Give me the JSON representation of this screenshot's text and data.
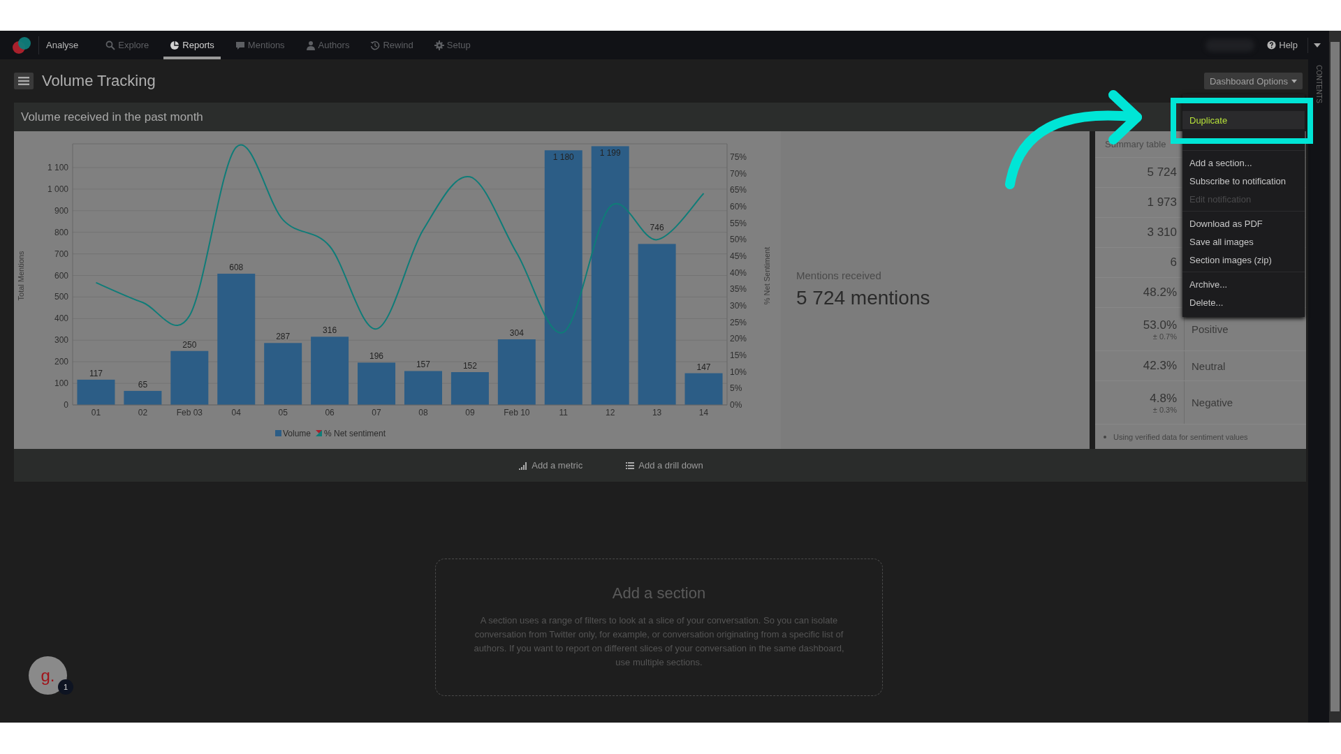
{
  "nav": {
    "app_label": "Analyse",
    "items": [
      {
        "label": "Explore",
        "selected": false
      },
      {
        "label": "Reports",
        "selected": true
      },
      {
        "label": "Mentions",
        "selected": false
      },
      {
        "label": "Authors",
        "selected": false
      },
      {
        "label": "Rewind",
        "selected": false
      },
      {
        "label": "Setup",
        "selected": false
      }
    ],
    "help": "Help"
  },
  "page": {
    "title": "Volume Tracking",
    "options_button": "Dashboard Options",
    "side_tab": "CONTENTS"
  },
  "section": {
    "title": "Volume received in the past month",
    "charts": [
      {
        "chart_data": {
          "type": "bar",
          "ylabel": "Total Mentions",
          "categories": [
            "01",
            "02",
            "Feb 03",
            "04",
            "05",
            "06",
            "07",
            "08",
            "09",
            "Feb 10",
            "11",
            "12",
            "13",
            "14"
          ],
          "series": [
            {
              "name": "Volume",
              "color": "#2c5d86",
              "values": [
                117,
                65,
                250,
                608,
                287,
                316,
                196,
                157,
                152,
                304,
                1180,
                1199,
                746,
                147
              ]
            }
          ],
          "ylim": [
            0,
            1210
          ],
          "grid": true,
          "data_labels": true,
          "yticks": [
            0,
            100,
            200,
            300,
            400,
            500,
            600,
            700,
            800,
            900,
            {
              "value": 1000,
              "label": "1 000"
            },
            {
              "value": 1100,
              "label": "1 100"
            }
          ]
        }
      },
      {
        "chart_data": {
          "type": "line",
          "ylabel": "% Net Sentiment",
          "series": [
            {
              "name": "% Net sentiment",
              "color": "#0f7c78",
              "values": [
                37,
                31,
                27,
                78,
                56,
                48,
                23,
                53,
                69,
                46,
                22,
                60,
                50,
                64
              ]
            }
          ],
          "ylim": [
            0,
            79
          ],
          "yticks": [
            {
              "value": 0,
              "label": "0%"
            },
            {
              "value": 5,
              "label": "5%"
            },
            {
              "value": 10,
              "label": "10%"
            },
            {
              "value": 15,
              "label": "15%"
            },
            {
              "value": 20,
              "label": "20%"
            },
            {
              "value": 25,
              "label": "25%"
            },
            {
              "value": 30,
              "label": "30%"
            },
            {
              "value": 35,
              "label": "35%"
            },
            {
              "value": 40,
              "label": "40%"
            },
            {
              "value": 45,
              "label": "45%"
            },
            {
              "value": 50,
              "label": "50%"
            },
            {
              "value": 55,
              "label": "55%"
            },
            {
              "value": 60,
              "label": "60%"
            },
            {
              "value": 65,
              "label": "65%"
            },
            {
              "value": 70,
              "label": "70%"
            },
            {
              "value": 75,
              "label": "75%"
            }
          ]
        }
      }
    ],
    "metric": {
      "label": "Mentions received",
      "value": "5 724 mentions"
    },
    "summary": {
      "title": "Summary table",
      "rows": [
        {
          "value": "5 724"
        },
        {
          "value": "1 973"
        },
        {
          "value": "3 310"
        },
        {
          "value": "6"
        },
        {
          "value": "48.2%"
        },
        {
          "value": "53.0%",
          "margin": "± 0.7%",
          "label": "Positive"
        },
        {
          "value": "42.3%",
          "label": "Neutral"
        },
        {
          "value": "4.8%",
          "margin": "± 0.3%",
          "label": "Negative"
        }
      ],
      "note": "Using verified data for sentiment values"
    },
    "actions": [
      {
        "label": "Add a metric"
      },
      {
        "label": "Add a drill down"
      }
    ]
  },
  "add_section": {
    "title": "Add a section",
    "text": "A section uses a range of filters to look at a slice of your conversation. So you can isolate conversation from Twitter only, for example, or conversation originating from a specific list of authors. If you want to report on different slices of your conversation in the same dashboard, use multiple sections."
  },
  "menu": {
    "groups": [
      [
        {
          "label": "Duplicate",
          "selected": true,
          "disabled": false
        }
      ],
      [
        {
          "label": "Add a section...",
          "selected": false,
          "disabled": false
        },
        {
          "label": "Subscribe to notification",
          "selected": false,
          "disabled": false
        },
        {
          "label": "Edit notification",
          "selected": false,
          "disabled": true
        }
      ],
      [
        {
          "label": "Download as PDF",
          "selected": false,
          "disabled": false
        },
        {
          "label": "Save all images",
          "selected": false,
          "disabled": false
        },
        {
          "label": "Section images (zip)",
          "selected": false,
          "disabled": false
        }
      ],
      [
        {
          "label": "Archive...",
          "selected": false,
          "disabled": false
        },
        {
          "label": "Delete...",
          "selected": false,
          "disabled": false
        }
      ]
    ]
  },
  "chat": {
    "avatar_text": "g.",
    "badge": "1"
  }
}
